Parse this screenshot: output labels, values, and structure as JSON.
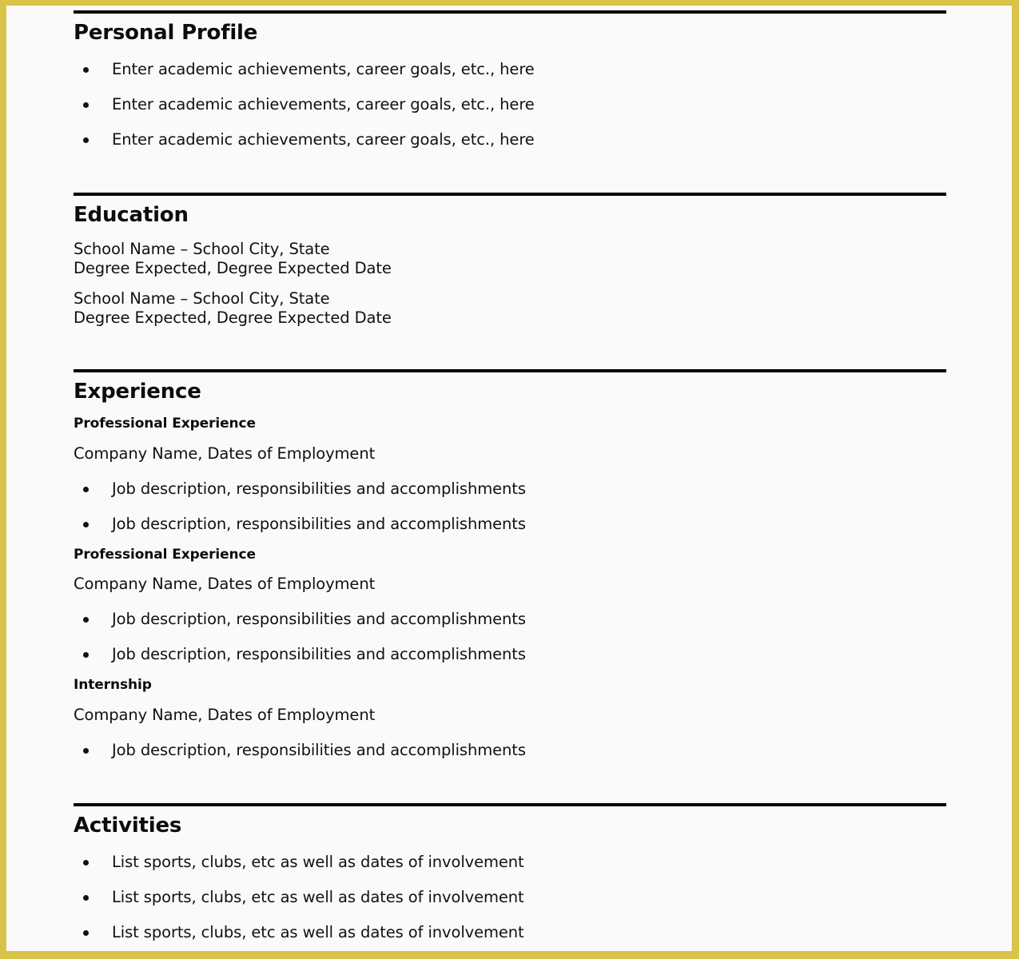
{
  "document": {
    "type": "resume-template",
    "accent_border_color": "#d9c348",
    "page_background": "#fbf9fa",
    "rule_color": "#000000",
    "text_color": "#111111"
  },
  "sections": [
    {
      "id": "personal-profile",
      "title": "Personal Profile",
      "bullets": [
        "Enter academic achievements, career goals, etc., here",
        "Enter academic achievements, career goals, etc., here",
        "Enter academic achievements, career goals, etc., here"
      ]
    },
    {
      "id": "education",
      "title": "Education",
      "entries": [
        {
          "school": "School Name – School City, State",
          "degree": "Degree Expected, Degree Expected Date"
        },
        {
          "school": "School Name – School City, State",
          "degree": "Degree Expected, Degree Expected Date"
        }
      ]
    },
    {
      "id": "experience",
      "title": "Experience",
      "entries": [
        {
          "subtitle": "Professional Experience",
          "company": "Company Name, Dates of Employment",
          "bullets": [
            "Job description, responsibilities and accomplishments",
            "Job description, responsibilities and accomplishments"
          ]
        },
        {
          "subtitle": "Professional Experience",
          "company": "Company Name, Dates of Employment",
          "bullets": [
            "Job description, responsibilities and accomplishments",
            "Job description, responsibilities and accomplishments"
          ]
        },
        {
          "subtitle": "Internship",
          "company": "Company Name, Dates of Employment",
          "bullets": [
            "Job description, responsibilities and accomplishments"
          ]
        }
      ]
    },
    {
      "id": "activities",
      "title": "Activities",
      "bullets": [
        "List sports, clubs, etc as well as dates of involvement",
        "List sports, clubs, etc as well as dates of involvement",
        "List sports, clubs, etc as well as dates of involvement"
      ]
    }
  ]
}
